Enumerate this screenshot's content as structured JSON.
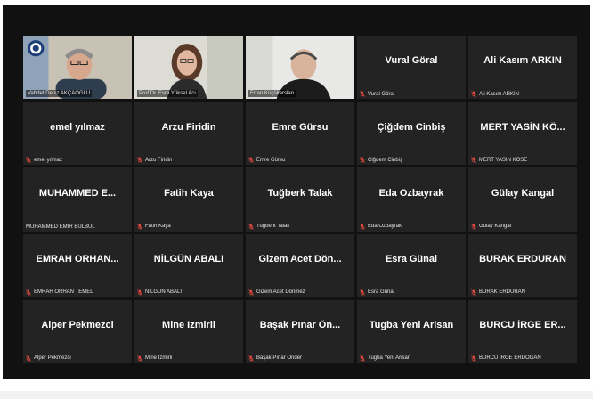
{
  "colors": {
    "stage": "#111111",
    "tile": "#232323",
    "muted_icon": "#e04a3f",
    "active_border": "#c9c97a"
  },
  "participants": [
    {
      "video": true,
      "label": "Vahdet Deniz AKÇAOĞLU",
      "muted": false
    },
    {
      "video": true,
      "label": "Prof.Dr. Esra Yüksel Acı",
      "muted": false,
      "active": true
    },
    {
      "video": true,
      "label": "Ertan Küçükarslan",
      "muted": false
    },
    {
      "video": false,
      "name": "Vural Göral",
      "label": "Vural Göral",
      "muted": true
    },
    {
      "video": false,
      "name": "Ali Kasım ARKIN",
      "label": "Ali Kasım ARKIN",
      "muted": true
    },
    {
      "video": false,
      "name": "emel yılmaz",
      "label": "emel yılmaz",
      "muted": true
    },
    {
      "video": false,
      "name": "Arzu Firidin",
      "label": "Arzu Firidin",
      "muted": true
    },
    {
      "video": false,
      "name": "Emre Gürsu",
      "label": "Emre Gürsu",
      "muted": true
    },
    {
      "video": false,
      "name": "Çiğdem Cinbiş",
      "label": "Çiğdem Cinbiş",
      "muted": true
    },
    {
      "video": false,
      "name": "MERT YASİN KÖ...",
      "label": "MERT YASİN KÖSE",
      "muted": true
    },
    {
      "video": false,
      "name": "MUHAMMED E...",
      "label": "MUHAMMED EMİR BÜLBÜL",
      "muted": false
    },
    {
      "video": false,
      "name": "Fatih Kaya",
      "label": "Fatih Kaya",
      "muted": true
    },
    {
      "video": false,
      "name": "Tuğberk Talak",
      "label": "Tuğberk Talak",
      "muted": true
    },
    {
      "video": false,
      "name": "Eda Ozbayrak",
      "label": "Eda Ozbayrak",
      "muted": true
    },
    {
      "video": false,
      "name": "Gülay Kangal",
      "label": "Gülay Kangal",
      "muted": true
    },
    {
      "video": false,
      "name": "EMRAH ORHAN...",
      "label": "EMRAH ORHAN TEMEL",
      "muted": true
    },
    {
      "video": false,
      "name": "NİLGÜN ABALI",
      "label": "NİLGÜN ABALI",
      "muted": true
    },
    {
      "video": false,
      "name": "Gizem Acet Dön...",
      "label": "Gizem Acet Dönmez",
      "muted": true
    },
    {
      "video": false,
      "name": "Esra Günal",
      "label": "Esra Günal",
      "muted": true
    },
    {
      "video": false,
      "name": "BURAK ERDURAN",
      "label": "BURAK ERDURAN",
      "muted": true
    },
    {
      "video": false,
      "name": "Alper Pekmezci",
      "label": "Alper Pekmezci",
      "muted": true
    },
    {
      "video": false,
      "name": "Mine Izmirli",
      "label": "Mine Izmirli",
      "muted": true
    },
    {
      "video": false,
      "name": "Başak Pınar Ön...",
      "label": "Başak Pınar Önder",
      "muted": true
    },
    {
      "video": false,
      "name": "Tugba Yeni Arisan",
      "label": "Tugba Yeni Arisan",
      "muted": true
    },
    {
      "video": false,
      "name": "BURCU İRGE ER...",
      "label": "BURCU İRGE ERDOĞAN",
      "muted": true
    }
  ]
}
